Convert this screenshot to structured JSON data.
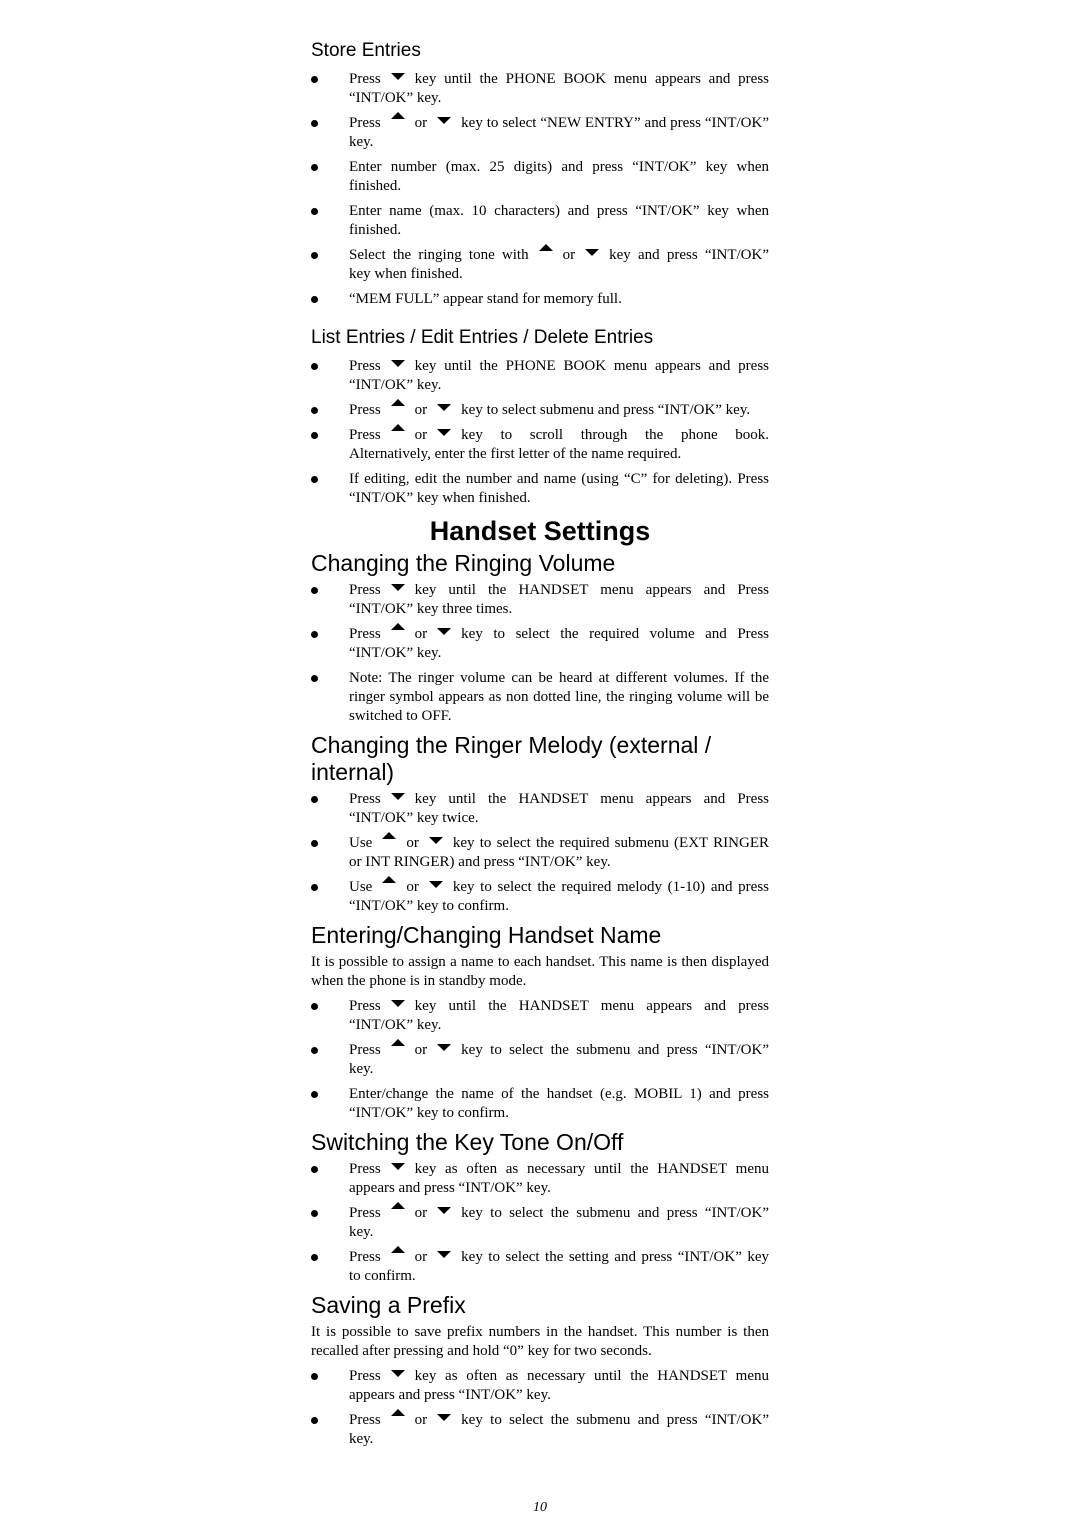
{
  "store_entries": {
    "title": "Store Entries",
    "items": [
      [
        "Press",
        "down",
        "key until the PHONE BOOK menu appears and press “INT/OK” key."
      ],
      [
        "Press",
        "up",
        "or",
        "down",
        "key to select “NEW ENTRY” and press “INT/OK” key."
      ],
      [
        "Enter number (max. 25 digits) and press “INT/OK” key when finished."
      ],
      [
        "Enter name (max. 10 characters) and press “INT/OK” key when finished."
      ],
      [
        "Select the ringing tone with",
        "up",
        "or",
        "down",
        "key and press “INT/OK” key when finished."
      ],
      [
        "“MEM FULL” appear stand for memory full."
      ]
    ]
  },
  "list_entries": {
    "title": "List Entries / Edit Entries / Delete Entries",
    "items": [
      [
        "Press",
        "down",
        "key until the PHONE BOOK menu appears and press “INT/OK” key."
      ],
      [
        "Press",
        "up",
        "or",
        "down",
        "key to select submenu and press “INT/OK” key."
      ],
      [
        "Press",
        "up",
        "or",
        "down",
        "key to scroll through the phone book. Alternatively, enter the first letter of the name required."
      ],
      [
        "If editing, edit the number and name (using “C” for deleting). Press “INT/OK” key when finished."
      ]
    ]
  },
  "main_title": "Handset Settings",
  "ringing_volume": {
    "title": "Changing the Ringing Volume",
    "items": [
      [
        "Press",
        "down",
        "key until the HANDSET menu appears and Press “INT/OK” key three times."
      ],
      [
        "Press",
        "up",
        "or",
        "down",
        "key to select the required volume and Press “INT/OK” key."
      ],
      [
        "Note: The ringer volume can be heard at different volumes. If the ringer symbol appears as non dotted line, the ringing volume will be switched to OFF."
      ]
    ]
  },
  "ringer_melody": {
    "title": "Changing the Ringer Melody (external / internal)",
    "items": [
      [
        "Press",
        "down",
        "key until the HANDSET menu appears and Press “INT/OK” key twice."
      ],
      [
        "Use",
        "up",
        "or",
        "down",
        "key to select the required submenu (EXT RINGER or INT RINGER) and press “INT/OK” key."
      ],
      [
        "Use",
        "up",
        "or",
        "down",
        "key to select the required melody (1-10) and press “INT/OK” key to confirm."
      ]
    ]
  },
  "handset_name": {
    "title": "Entering/Changing Handset Name",
    "intro": "It is possible to assign a name to each handset. This name is then displayed when the phone is in standby mode.",
    "items": [
      [
        "Press",
        "down",
        "key until the HANDSET menu appears and press “INT/OK” key."
      ],
      [
        "Press",
        "up",
        "or",
        "down",
        "key to select the submenu and press “INT/OK” key."
      ],
      [
        "Enter/change the name of the handset (e.g. MOBIL 1) and press “INT/OK” key to confirm."
      ]
    ]
  },
  "key_tone": {
    "title": "Switching the Key Tone On/Off",
    "items": [
      [
        "Press",
        "down",
        "key as often as necessary until the HANDSET menu appears and press “INT/OK” key."
      ],
      [
        "Press",
        "up",
        "or",
        "down",
        "key to select the submenu and press “INT/OK” key."
      ],
      [
        "Press",
        "up",
        "or",
        "down",
        "key to select the setting and press “INT/OK” key to confirm."
      ]
    ]
  },
  "prefix": {
    "title": "Saving a Prefix",
    "intro": "It is possible to save prefix numbers in the handset. This number is then recalled after pressing and hold “0” key for two seconds.",
    "items": [
      [
        "Press",
        "down",
        "key as often as necessary until the HANDSET menu appears and press “INT/OK” key."
      ],
      [
        "Press",
        "up",
        "or",
        "down",
        "key to select the submenu and press “INT/OK” key."
      ]
    ]
  },
  "page_number": "10"
}
